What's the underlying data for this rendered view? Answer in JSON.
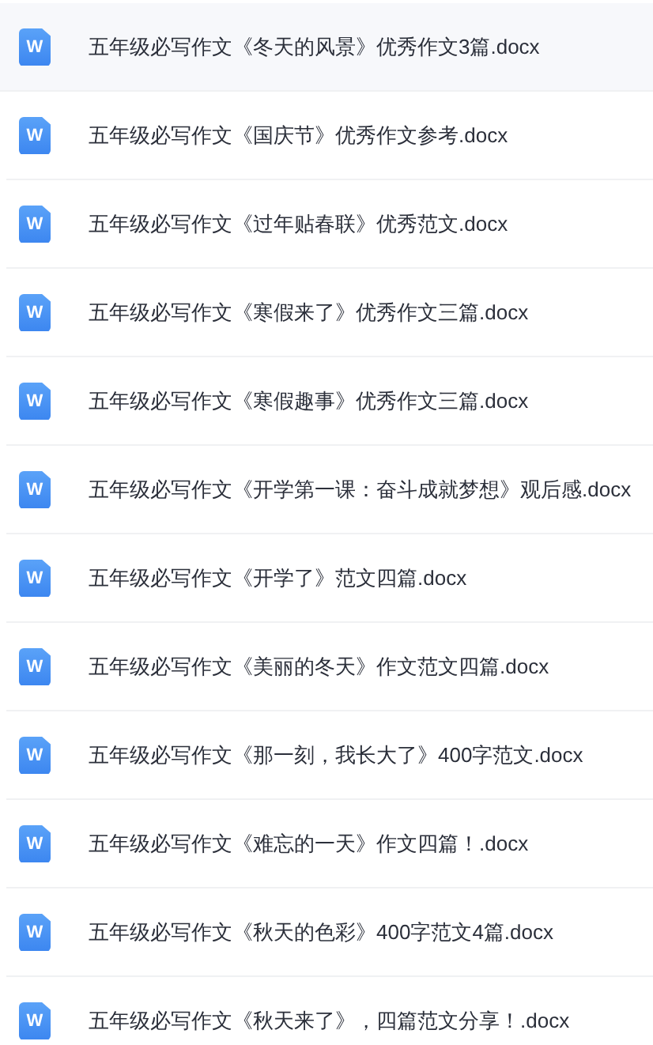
{
  "files": [
    {
      "name": "五年级必写作文《冬天的风景》优秀作文3篇.docx",
      "icon_label": "W",
      "selected": true
    },
    {
      "name": "五年级必写作文《国庆节》优秀作文参考.docx",
      "icon_label": "W",
      "selected": false
    },
    {
      "name": "五年级必写作文《过年贴春联》优秀范文.docx",
      "icon_label": "W",
      "selected": false
    },
    {
      "name": "五年级必写作文《寒假来了》优秀作文三篇.docx",
      "icon_label": "W",
      "selected": false
    },
    {
      "name": "五年级必写作文《寒假趣事》优秀作文三篇.docx",
      "icon_label": "W",
      "selected": false
    },
    {
      "name": "五年级必写作文《开学第一课：奋斗成就梦想》观后感.docx",
      "icon_label": "W",
      "selected": false
    },
    {
      "name": "五年级必写作文《开学了》范文四篇.docx",
      "icon_label": "W",
      "selected": false
    },
    {
      "name": "五年级必写作文《美丽的冬天》作文范文四篇.docx",
      "icon_label": "W",
      "selected": false
    },
    {
      "name": "五年级必写作文《那一刻，我长大了》400字范文.docx",
      "icon_label": "W",
      "selected": false
    },
    {
      "name": "五年级必写作文《难忘的一天》作文四篇！.docx",
      "icon_label": "W",
      "selected": false
    },
    {
      "name": "五年级必写作文《秋天的色彩》400字范文4篇.docx",
      "icon_label": "W",
      "selected": false
    },
    {
      "name": "五年级必写作文《秋天来了》，四篇范文分享！.docx",
      "icon_label": "W",
      "selected": false
    }
  ]
}
